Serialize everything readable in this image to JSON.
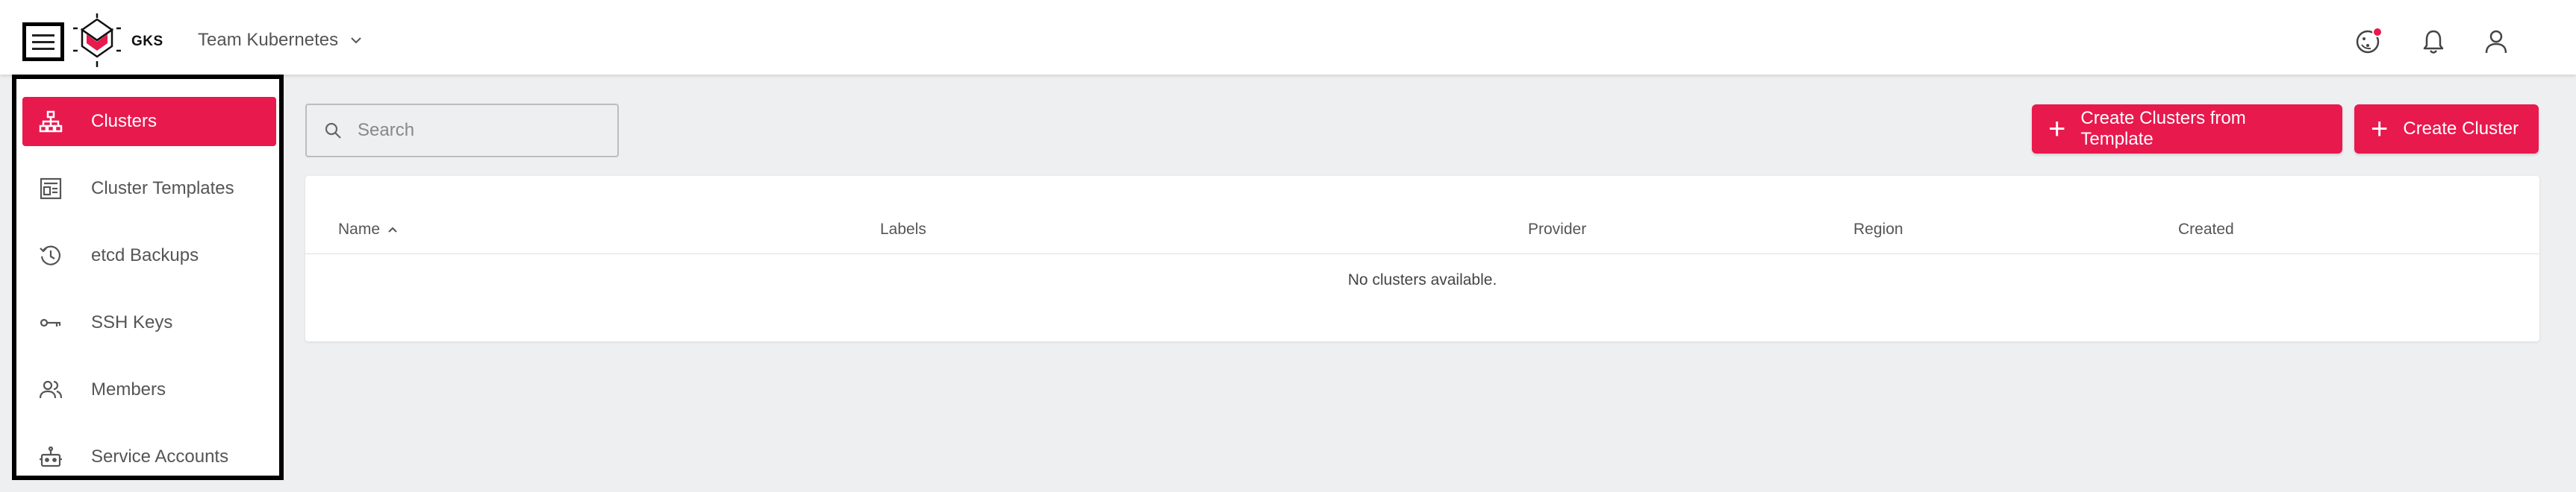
{
  "header": {
    "logo_text": "GKS",
    "project_name": "Team Kubernetes"
  },
  "sidebar": {
    "items": [
      {
        "label": "Clusters",
        "icon": "sitemap-icon",
        "active": true
      },
      {
        "label": "Cluster Templates",
        "icon": "template-icon",
        "active": false
      },
      {
        "label": "etcd Backups",
        "icon": "history-icon",
        "active": false
      },
      {
        "label": "SSH Keys",
        "icon": "key-icon",
        "active": false
      },
      {
        "label": "Members",
        "icon": "members-icon",
        "active": false
      },
      {
        "label": "Service Accounts",
        "icon": "robot-icon",
        "active": false
      }
    ]
  },
  "search": {
    "placeholder": "Search",
    "value": ""
  },
  "actions": {
    "create_from_template": "Create Clusters from Template",
    "create_cluster": "Create Cluster"
  },
  "table": {
    "columns": [
      "Name",
      "Labels",
      "Provider",
      "Region",
      "Created"
    ],
    "sorted_column": "Name",
    "sort_direction": "ascending",
    "empty_message": "No clusters available."
  },
  "colors": {
    "accent": "#e8194d",
    "background": "#eeeff1"
  }
}
